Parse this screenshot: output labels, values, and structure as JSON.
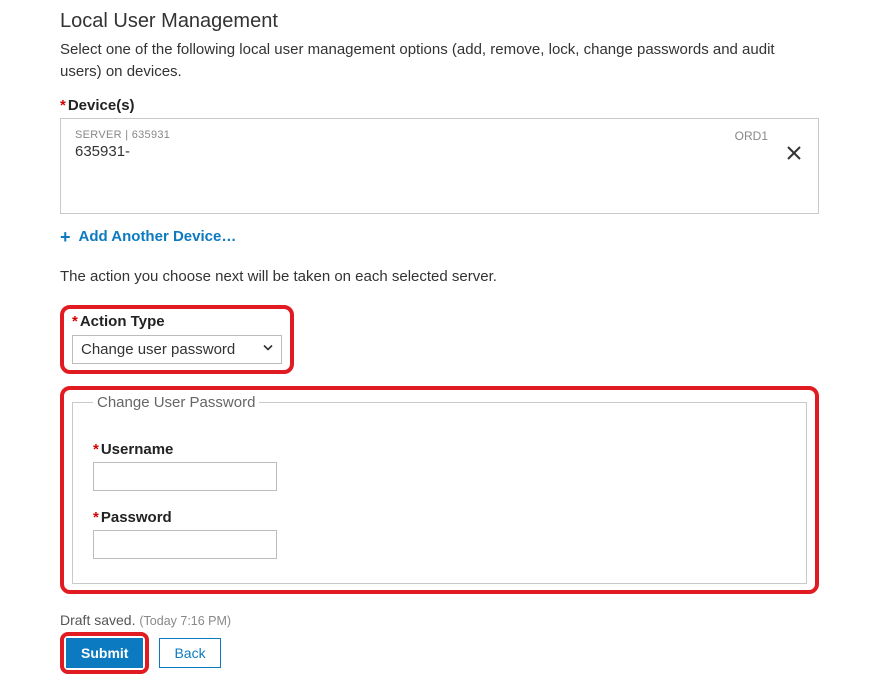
{
  "page": {
    "title": "Local User Management",
    "intro": "Select one of the following local user management options (add, remove, lock, change passwords and audit users) on devices.",
    "devices_label": "Device(s)",
    "subtext": "The action you choose next will be taken on each selected server."
  },
  "device": {
    "meta": "SERVER | 635931",
    "name": "635931-",
    "region": "ORD1"
  },
  "add_link": "Add Another Device…",
  "action_type": {
    "label": "Action Type",
    "selected": "Change user password"
  },
  "change_password": {
    "legend": "Change User Password",
    "username_label": "Username",
    "username_value": "",
    "password_label": "Password",
    "password_value": ""
  },
  "draft": {
    "text": "Draft saved.",
    "timestamp": "(Today 7:16 PM)"
  },
  "buttons": {
    "submit": "Submit",
    "back": "Back"
  }
}
